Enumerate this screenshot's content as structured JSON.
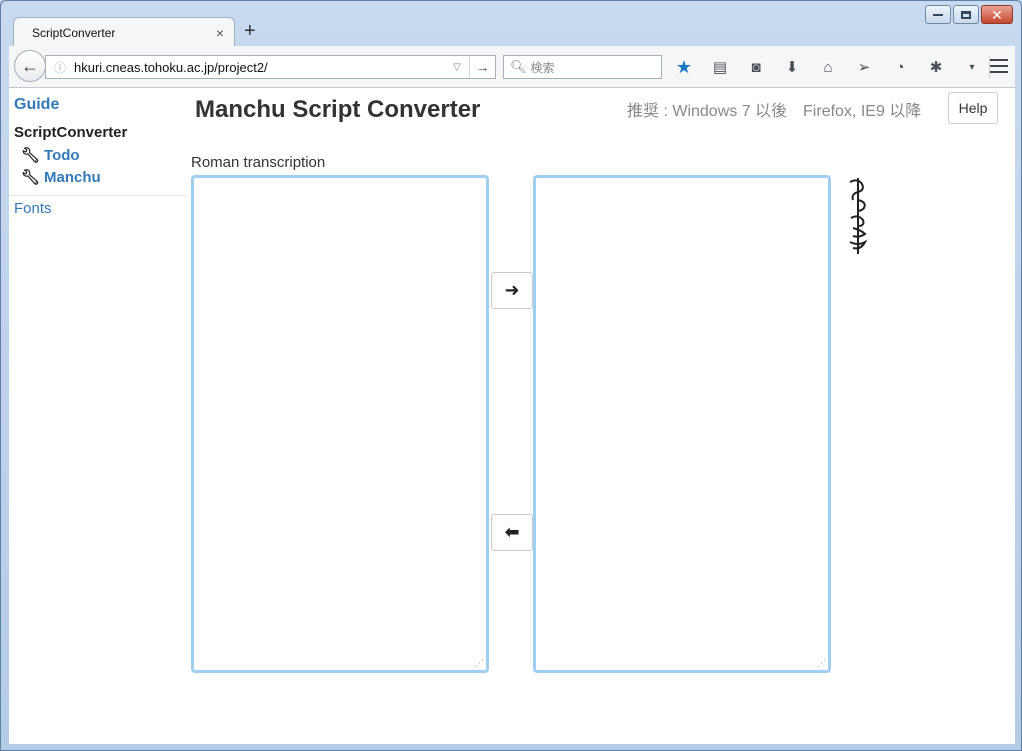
{
  "browser": {
    "tab_title": "ScriptConverter",
    "tab_close": "×",
    "new_tab": "+",
    "url": "hkuri.cneas.tohoku.ac.jp/project2/",
    "search_placeholder": "検索",
    "icons": [
      "back-arrow-icon",
      "info-icon",
      "star-icon",
      "reading-list-icon",
      "pocket-icon",
      "download-icon",
      "home-icon",
      "send-icon",
      "history-icon",
      "extension-icon",
      "menu-icon"
    ]
  },
  "sidebar": {
    "guide": "Guide",
    "current": "ScriptConverter",
    "items": [
      {
        "label": "Todo"
      },
      {
        "label": "Manchu"
      }
    ],
    "fonts": "Fonts"
  },
  "header": {
    "title": "Manchu Script Converter",
    "recommend": "推奨 : Windows 7 以後　Firefox, IE9 以降",
    "help": "Help"
  },
  "main": {
    "roman_label": "Roman transcription",
    "left_text": "",
    "right_text": "",
    "convert_right": "➜",
    "convert_left": "⬅"
  }
}
